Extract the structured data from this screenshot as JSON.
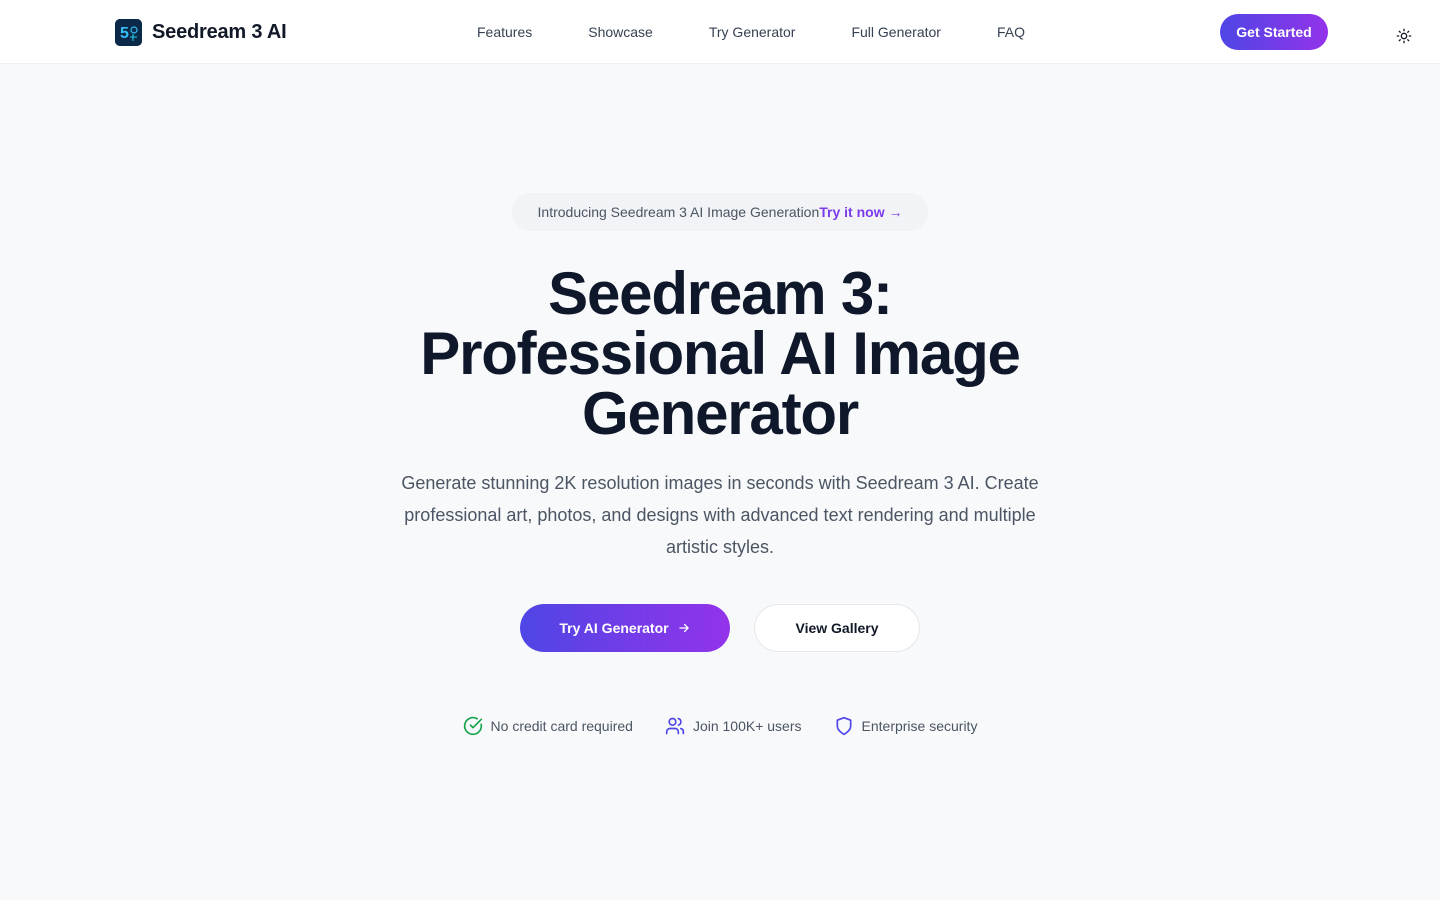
{
  "header": {
    "brand": {
      "name": "Seedream 3 AI",
      "logo_icon": "seedream-logo-icon"
    },
    "nav": [
      {
        "label": "Features"
      },
      {
        "label": "Showcase"
      },
      {
        "label": "Try Generator"
      },
      {
        "label": "Full Generator"
      },
      {
        "label": "FAQ"
      }
    ],
    "cta_label": "Get Started",
    "theme_toggle_icon": "sun-icon"
  },
  "hero": {
    "badge": {
      "text": "Introducing Seedream 3 AI Image Generation",
      "link_label": "Try it now →"
    },
    "title_line1": "Seedream 3:",
    "title_line2": "Professional AI Image",
    "title_line3": "Generator",
    "subtitle": "Generate stunning 2K resolution images in seconds with Seedream 3 AI. Create professional art, photos, and designs with advanced text rendering and multiple artistic styles.",
    "primary_button": {
      "label": "Try AI Generator",
      "icon": "arrow-right-icon"
    },
    "secondary_button": {
      "label": "View Gallery"
    },
    "trust": [
      {
        "label": "No credit card required",
        "icon": "check-circle-icon",
        "color": "#16a34a"
      },
      {
        "label": "Join 100K+ users",
        "icon": "users-icon",
        "color": "#4f46e5"
      },
      {
        "label": "Enterprise security",
        "icon": "shield-icon",
        "color": "#4f46e5"
      }
    ]
  },
  "colors": {
    "accent_start": "#4f46e5",
    "accent_end": "#9333ea",
    "link": "#7c3aed",
    "background": "#f8f9fb"
  }
}
